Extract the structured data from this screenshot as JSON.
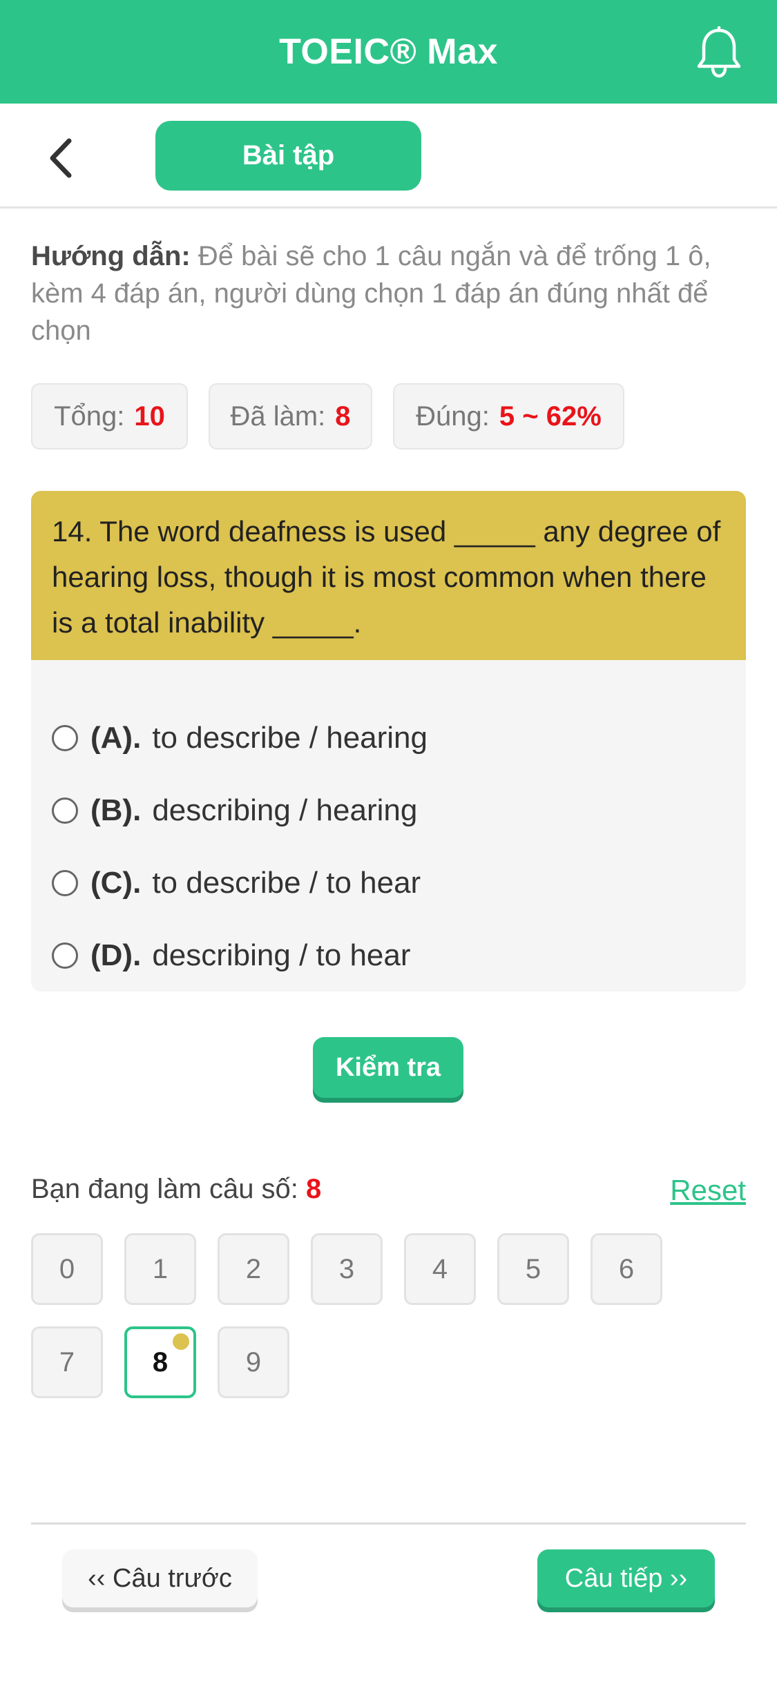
{
  "header": {
    "title": "TOEIC® Max",
    "bell_icon": "bell-icon"
  },
  "subnav": {
    "back_icon": "chevron-left-icon",
    "tab_label": "Bài tập"
  },
  "instructions": {
    "label": "Hướng dẫn:",
    "text": " Để bài sẽ cho 1 câu ngắn và để trống 1 ô, kèm 4 đáp án, người dùng chọn 1 đáp án đúng nhất để chọn"
  },
  "stats": {
    "total_label": "Tổng:",
    "total_value": "10",
    "done_label": "Đã làm:",
    "done_value": "8",
    "correct_label": "Đúng:",
    "correct_value": "5 ~ 62%"
  },
  "question": {
    "text": "14. The word deafness is used _____ any degree of hearing loss, though it is most common when there is a total inability _____.",
    "options": [
      {
        "letter": "(A).",
        "text": "to describe / hearing"
      },
      {
        "letter": "(B).",
        "text": "describing / hearing"
      },
      {
        "letter": "(C).",
        "text": "to describe / to hear"
      },
      {
        "letter": "(D).",
        "text": "describing / to hear"
      }
    ]
  },
  "check_button": "Kiểm tra",
  "progress": {
    "label": "Bạn đang làm câu số: ",
    "current": "8",
    "reset_label": "Reset",
    "numbers": [
      "0",
      "1",
      "2",
      "3",
      "4",
      "5",
      "6",
      "7",
      "8",
      "9"
    ],
    "active_index": 8
  },
  "footer": {
    "prev_label": "‹‹ Câu trước",
    "next_label": "Câu tiếp ››"
  },
  "colors": {
    "brand": "#2dc48a",
    "question_bg": "#dcc24f",
    "highlight": "#e8141a"
  }
}
